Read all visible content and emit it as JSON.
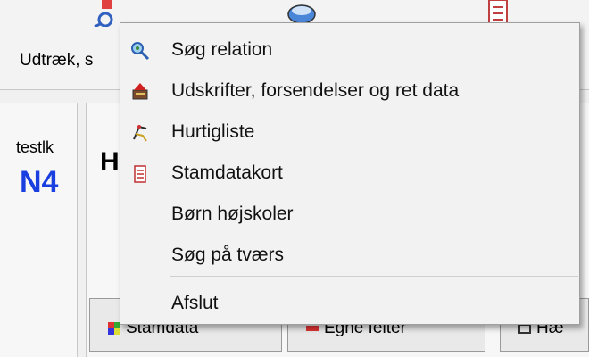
{
  "ribbon": {
    "button_label": "Udtræk, s"
  },
  "background": {
    "left_label": "testlk",
    "left_value": "N4",
    "heading": "H",
    "tabs": [
      {
        "label": "Stamdata",
        "icon": "stamdata-icon"
      },
      {
        "label": "Egne felter",
        "icon": "egne-felter-icon"
      },
      {
        "label": "Hæ",
        "icon": "tab-icon"
      }
    ]
  },
  "menu": {
    "items": [
      {
        "label": "Søg relation",
        "icon": "search-relation-icon"
      },
      {
        "label": "Udskrifter, forsendelser og ret data",
        "icon": "print-send-icon"
      },
      {
        "label": "Hurtigliste",
        "icon": "quicklist-icon"
      },
      {
        "label": "Stamdatakort",
        "icon": "card-icon"
      },
      {
        "label": "Børn højskoler",
        "icon": ""
      },
      {
        "label": "Søg på tværs",
        "icon": ""
      }
    ],
    "exit_label": "Afslut"
  },
  "colors": {
    "accent_blue": "#1a3fe0",
    "menu_bg": "#f2f2f2"
  }
}
